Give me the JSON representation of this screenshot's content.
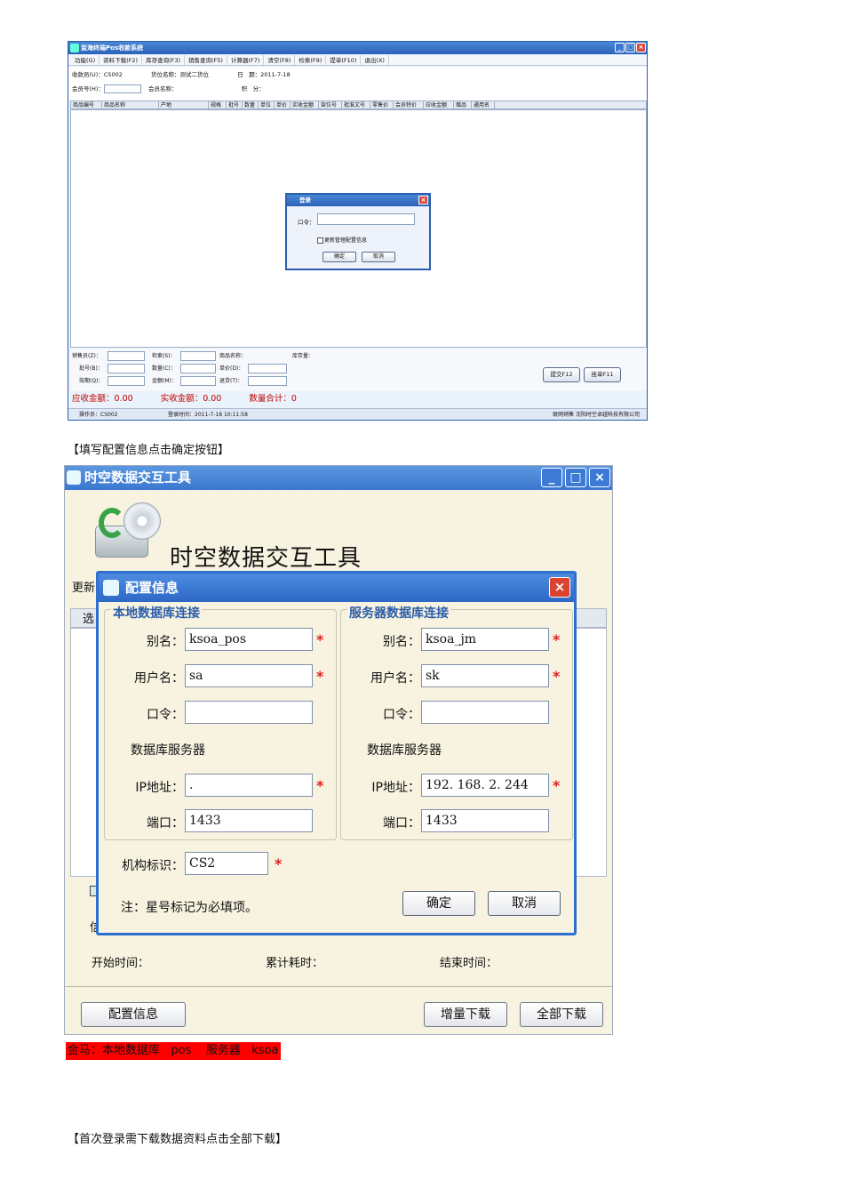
{
  "pos": {
    "title": "监海终端Pos收款系统",
    "menu": [
      "功能(G)",
      "资料下载(F2)",
      "库存查询(F3)",
      "销售查询(F5)",
      "计算器(F7)",
      "清空(F8)",
      "检索(F9)",
      "提单(F10)",
      "退出(X)"
    ],
    "cashier_label": "收款员(U)：",
    "cashier_value": "CS002",
    "location_label": "货位名称：",
    "location_value": "测试二货位",
    "date_label": "日　期：",
    "date_value": "2011-7-18",
    "member_no_label": "会员号(H)：",
    "member_name_label": "会员名称：",
    "points_label": "积　分：",
    "columns": [
      "商品编号",
      "商品名称",
      "产地",
      "规格",
      "批号",
      "数量",
      "单位",
      "单价",
      "实收金额",
      "架位号",
      "批准文号",
      "零售价",
      "会员特价",
      "应收金额",
      "赠品",
      "通用名"
    ],
    "login": {
      "title": "登录",
      "password_label": "口令：",
      "checkbox_label": "更新管理配置信息",
      "ok": "确定",
      "cancel": "取消"
    },
    "bottom": {
      "salesperson": "销售员(Z)：",
      "search": "检索(S)：",
      "product_name": "商品名称：",
      "stock": "库存量：",
      "batch": "批号(B)：",
      "quantity": "数量(C)：",
      "unit_price": "单价(D)：",
      "expiry": "效期(Q)：",
      "amount": "金额(M)：",
      "return": "退货(T)：",
      "submit": "提交F12",
      "hold": "挂单F11"
    },
    "totals": {
      "receivable": "应收金额：0.00",
      "received": "实收金额：0.00",
      "quantity": "数量合计：0"
    },
    "status": {
      "operator": "操作员：CS002",
      "login_time": "登录时间：2011-7-18 10:11:58",
      "company": "联网销售 沈阳时空卓越科技有限公司"
    }
  },
  "caption1": "【填写配置信息点击确定按钮】",
  "tool": {
    "window_title": "时空数据交互工具",
    "banner_title": "时空数据交互工具",
    "tab_partial": "更新",
    "select_partial": "选",
    "partial_char": "信",
    "start_time": "开始时间：",
    "elapsed": "累计耗时：",
    "end_time": "结束时间：",
    "config_btn": "配置信息",
    "incremental_btn": "增量下载",
    "full_btn": "全部下载"
  },
  "config": {
    "title": "配置信息",
    "local_legend": "本地数据库连接",
    "server_legend": "服务器数据库连接",
    "alias_label": "别名：",
    "user_label": "用户名：",
    "password_label": "口令：",
    "db_server_label": "数据库服务器",
    "ip_label": "IP地址：",
    "port_label": "端口：",
    "local": {
      "alias": "ksoa_pos",
      "user": "sa",
      "password": "",
      "ip": ".",
      "port": "1433"
    },
    "server": {
      "alias": "ksoa_jm",
      "user": "sk",
      "password": "",
      "ip": "192. 168. 2. 244",
      "port": "1433"
    },
    "org_label": "机构标识：",
    "org_value": "CS2",
    "star": "*",
    "note": "注：星号标记为必填项。",
    "ok": "确定",
    "cancel": "取消"
  },
  "red_note": "金马：本地数据库   pos    服务器   ksoa",
  "caption2": "【首次登录需下载数据资料点击全部下载】"
}
